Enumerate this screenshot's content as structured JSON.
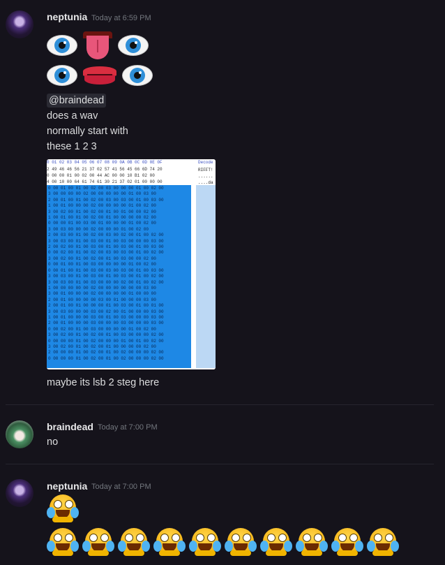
{
  "messages": [
    {
      "author": "neptunia",
      "timestamp": "Today at 6:59 PM",
      "emoji_row_1": [
        "eyes-emoji",
        "tongue-emoji",
        "eyes-emoji"
      ],
      "emoji_row_2": [
        "eyes-emoji",
        "lips-emoji",
        "eyes-emoji"
      ],
      "mention": "@braindead",
      "lines": [
        "does a wav",
        "normally start with",
        "these 1 2 3"
      ],
      "attachment": {
        "header": "0 01 02 03 04 05 06 07 08 09 0A 0B 0C 0D 0E 0F",
        "decode_label": "Decode",
        "rows": [
          "2 49 46 46 56 21 37 02 57 41 56 45 66 6D 74 20",
          "0 00 00 01 00 02 00 44 AC 00 00 10 B1 02 00",
          "4 00 10 00 64 61 74 61 30 21 37 02 01 00 00 00"
        ],
        "decode_rows": [
          "RIFFT!",
          "......",
          "....da"
        ],
        "selected_rows": [
          "0 00 01 00 01 00 02 00 03 00 00 00 01 00 02 00",
          "3 00 00 00 00 02 00 00 00 00 00 01 00 03 00",
          "2 00 01 00 01 00 02 00 03 00 03 00 01 00 03 00",
          "1 00 01 00 00 00 02 00 00 00 00 01 00 02 00",
          "3 00 02 00 01 00 02 00 01 00 01 00 00 02 00",
          "1 00 01 00 01 00 02 00 01 00 00 00 00 02 00",
          "0 00 00 01 00 03 00 01 00 00 00 01 00 02 00",
          "3 00 03 00 00 00 02 00 00 00 01 00 02 00",
          "2 00 03 00 01 00 02 00 03 00 02 00 01 00 02 00",
          "3 00 03 00 01 00 03 00 01 00 03 00 00 00 03 00",
          "2 00 02 00 01 00 03 00 01 00 03 00 01 00 03 00",
          "0 00 02 00 01 00 02 00 03 00 03 00 01 00 02 00",
          "3 00 02 00 01 00 02 00 01 00 03 00 00 02 00",
          "0 00 01 00 01 00 03 00 00 00 00 01 00 02 00",
          "0 00 01 00 01 00 03 00 03 00 03 00 01 00 03 00",
          "3 00 03 00 01 00 03 00 01 00 03 00 01 00 02 00",
          "3 00 03 00 01 00 03 00 00 00 02 00 01 00 02 00",
          "1 00 00 00 00 00 02 00 00 00 00 00 00 03 00",
          "3 00 01 00 00 00 02 00 00 00 00 01 00 00 00",
          "2 00 01 00 00 00 00 03 00 01 00 00 00 03 00",
          "2 00 01 00 01 00 00 00 01 00 03 00 01 00 01 00",
          "3 00 03 00 00 00 03 00 02 00 01 00 00 00 03 00",
          "1 00 01 00 00 00 03 00 01 00 03 00 00 00 03 00",
          "2 00 01 00 00 00 03 00 00 00 03 00 00 00 03 00",
          "0 00 02 00 01 00 03 00 00 00 00 01 00 02 00",
          "3 00 02 00 01 00 02 00 01 00 03 00 00 00 02 00",
          "0 00 00 00 01 00 02 00 00 00 01 00 01 00 02 00",
          "3 00 02 00 01 00 02 00 01 00 00 00 00 02 00",
          "2 00 00 00 01 00 02 00 01 00 02 00 00 00 02 00",
          "0 00 00 00 01 00 02 00 01 00 02 00 00 00 02 00"
        ]
      },
      "after_text": "maybe its lsb 2 steg here"
    },
    {
      "author": "braindead",
      "timestamp": "Today at 7:00 PM",
      "text": "no"
    },
    {
      "author": "neptunia",
      "timestamp": "Today at 7:00 PM",
      "emoji_single": "rofl-emoji",
      "emoji_row_count": 10
    }
  ],
  "colors": {
    "background": "#15131b",
    "username": "#e8e8ea",
    "timestamp": "#72767d",
    "text": "#dcddde",
    "mention_bg": "#2a2a33",
    "hex_selection": "#1e88e5"
  }
}
